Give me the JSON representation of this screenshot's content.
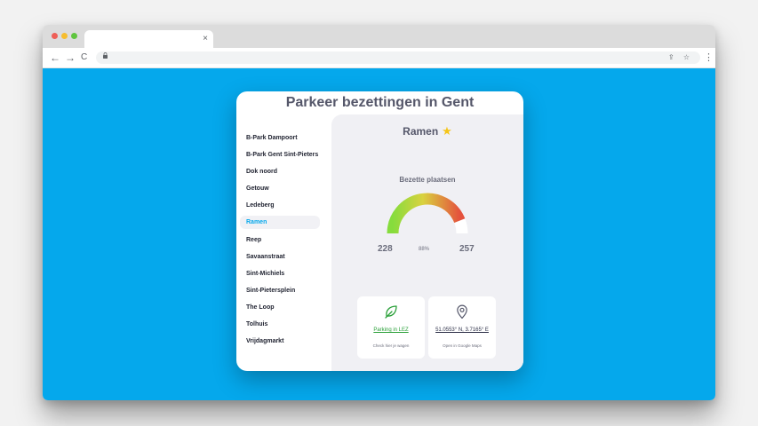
{
  "browser": {
    "tab_close": "×",
    "nav": {
      "back": "←",
      "forward": "→",
      "reload": "C"
    },
    "address_icons": "⇪ ☆",
    "menu": "⋮"
  },
  "colors": {
    "page_background": "#05a8ec",
    "accent": "#05a8ec",
    "lez_green": "#2aa039",
    "star": "#f5c518"
  },
  "app": {
    "title": "Parkeer bezettingen in Gent",
    "sidebar": {
      "items": [
        {
          "label": "B-Park Dampoort",
          "active": false
        },
        {
          "label": "B-Park Gent Sint-Pieters",
          "active": false
        },
        {
          "label": "Dok noord",
          "active": false
        },
        {
          "label": "Getouw",
          "active": false
        },
        {
          "label": "Ledeberg",
          "active": false
        },
        {
          "label": "Ramen",
          "active": true
        },
        {
          "label": "Reep",
          "active": false
        },
        {
          "label": "Savaanstraat",
          "active": false
        },
        {
          "label": "Sint-Michiels",
          "active": false
        },
        {
          "label": "Sint-Pietersplein",
          "active": false
        },
        {
          "label": "The Loop",
          "active": false
        },
        {
          "label": "Tolhuis",
          "active": false
        },
        {
          "label": "Vrijdagmarkt",
          "active": false
        }
      ]
    },
    "detail": {
      "name": "Ramen",
      "favorite_icon": "star-icon",
      "star_glyph": "★",
      "occupancy_label": "Bezette plaatsen",
      "gauge": {
        "occupied": "228",
        "percent": "88%",
        "capacity": "257",
        "fill_fraction": 0.88
      },
      "lez_card": {
        "icon": "leaf-icon",
        "link": "Parking in LEZ",
        "subtext": "Check hier je wagen"
      },
      "maps_card": {
        "icon": "map-pin-icon",
        "link": "51.0553° N, 3.7165° E",
        "subtext": "Open in Google Maps"
      }
    }
  }
}
